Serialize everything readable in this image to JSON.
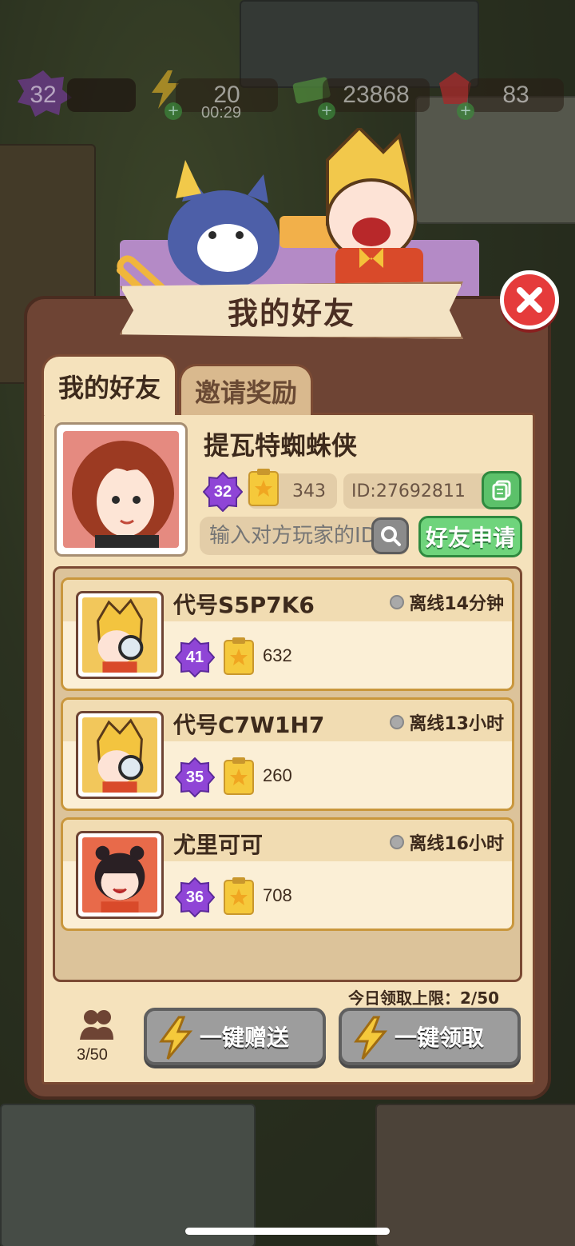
{
  "resources": {
    "level": "32",
    "energy": "20",
    "energy_timer": "00:29",
    "cash": "23868",
    "gems": "83",
    "plus": "+"
  },
  "dialog": {
    "title": "我的好友",
    "close_icon": "close-icon"
  },
  "tabs": [
    {
      "label": "我的好友",
      "active": true
    },
    {
      "label": "邀请奖励",
      "active": false
    }
  ],
  "profile": {
    "name": "提瓦特蜘蛛侠",
    "level": "32",
    "stars": "343",
    "id_text": "ID:27692811",
    "search_placeholder": "输入对方玩家的ID",
    "apply_label": "好友申请"
  },
  "friends": [
    {
      "name": "代号S5P7K6",
      "status": "离线14分钟",
      "level": "41",
      "stars": "632"
    },
    {
      "name": "代号C7W1H7",
      "status": "离线13小时",
      "level": "35",
      "stars": "260"
    },
    {
      "name": "尤里可可",
      "status": "离线16小时",
      "level": "36",
      "stars": "708"
    }
  ],
  "footer": {
    "daily_limit": "今日领取上限：2/50",
    "friend_count": "3/50",
    "send_all_label": "一键赠送",
    "claim_all_label": "一键领取"
  },
  "colors": {
    "panel_brown": "#6e4434",
    "cream": "#f5e2bc",
    "green_button": "#6fd47c",
    "close_red": "#e53b3b",
    "level_purple": "#8f45d6",
    "star_yellow": "#f5c93b"
  }
}
